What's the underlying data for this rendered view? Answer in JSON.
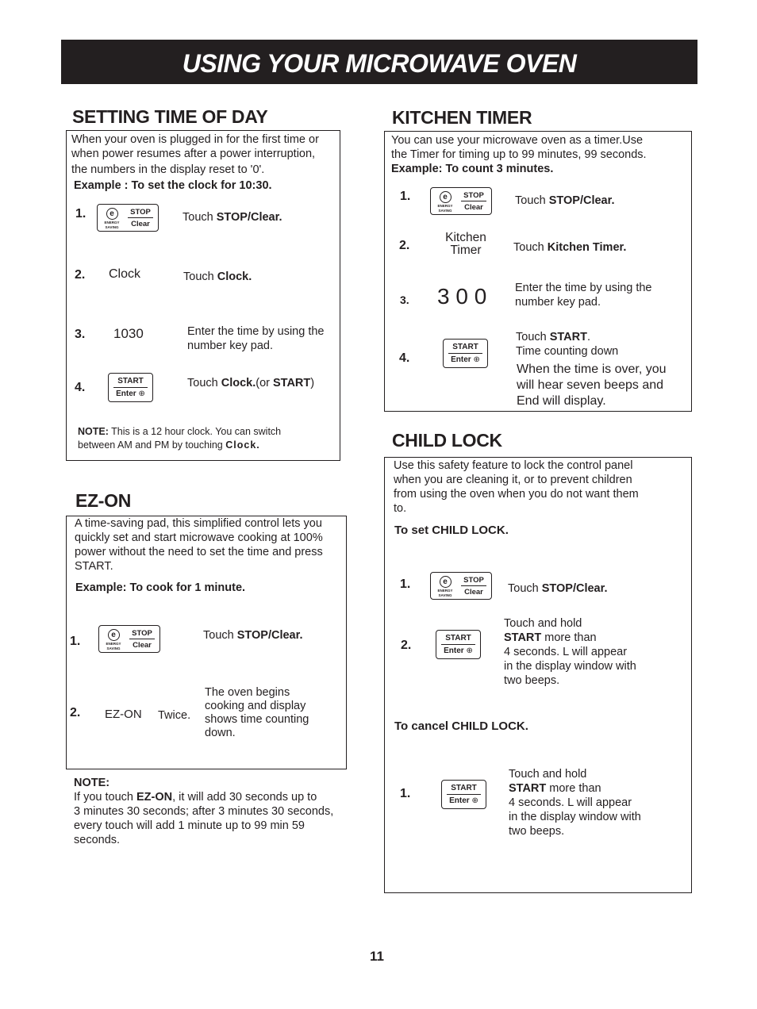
{
  "header": {
    "title": "USING YOUR MICROWAVE OVEN",
    "banner_color": "#231f20"
  },
  "keys": {
    "stop_clear": {
      "eco_glyph": "e",
      "eco_label_1": "ENERGY",
      "eco_label_2": "SAVING",
      "top": "STOP",
      "bottom": "Clear"
    },
    "start_enter": {
      "top": "START",
      "bottom": "Enter",
      "lock_glyph": "⊕"
    }
  },
  "setting_time": {
    "title": "SETTING TIME OF DAY",
    "intro_1": "When your oven is plugged in for the first time or",
    "intro_2": "when power resumes after a power interruption,",
    "intro_3": "the numbers in the display reset to '0'.",
    "example": "Example : To set the clock for 10:30.",
    "steps": [
      {
        "num": "1.",
        "pad": "STOP/Clear",
        "text_pre": "Touch ",
        "text_bold": "STOP/Clear."
      },
      {
        "num": "2.",
        "pad": "Clock",
        "text_pre": "Touch ",
        "text_bold": "Clock."
      },
      {
        "num": "3.",
        "pad": "1030",
        "text_1": "Enter the time by using the",
        "text_2": "number key pad."
      },
      {
        "num": "4.",
        "pad": "START/Enter",
        "text_pre": "Touch ",
        "text_bold": "Clock.",
        "text_mid": "(or ",
        "text_bold2": "START",
        "text_post": ")"
      }
    ],
    "note_label": "NOTE:",
    "note_1": " This is a 12 hour clock. You can switch",
    "note_2": "between AM and PM by touching ",
    "note_bold": "Clock."
  },
  "ez_on": {
    "title": "EZ-ON",
    "intro_1": "A time-saving pad, this simplified control lets you",
    "intro_2": "quickly set and start microwave cooking at 100%",
    "intro_3": "power without the need to set the time and press",
    "intro_4": "START.",
    "example": "Example: To cook for 1 minute.",
    "steps": [
      {
        "num": "1.",
        "pad": "STOP/Clear",
        "text_pre": "Touch ",
        "text_bold": "STOP/Clear."
      },
      {
        "num": "2.",
        "pad": "EZ-ON",
        "extra": "Twice.",
        "text_1": "The oven begins",
        "text_2": "cooking and display",
        "text_3": "shows time counting",
        "text_4": "down."
      }
    ],
    "note_label": "NOTE:",
    "note_1_pre": "If you touch ",
    "note_1_bold": "EZ-ON",
    "note_1_post": ", it will add 30 seconds up to",
    "note_2": "3 minutes 30 seconds; after 3 minutes 30 seconds,",
    "note_3": "every touch will add 1 minute up to 99 min 59",
    "note_4": "seconds."
  },
  "kitchen_timer": {
    "title": "KITCHEN TIMER",
    "intro_1": "You can use your microwave oven as a timer.Use",
    "intro_2": "the Timer for timing up to 99 minutes, 99 seconds.",
    "example": "Example: To count 3 minutes.",
    "steps": [
      {
        "num": "1.",
        "pad": "STOP/Clear",
        "text_pre": "Touch ",
        "text_bold": "STOP/Clear."
      },
      {
        "num": "2.",
        "pad_1": "Kitchen",
        "pad_2": "Timer",
        "text_pre": "Touch ",
        "text_bold": "Kitchen Timer."
      },
      {
        "num": "3.",
        "pad": "3 0 0",
        "text_1": "Enter the time by using the",
        "text_2": "number key pad."
      },
      {
        "num": "4.",
        "pad": "START/Enter",
        "text_pre": "Touch ",
        "text_bold": "START",
        "text_post": ".",
        "text_2": "Time counting down",
        "text_3": "When the time is over, you",
        "text_4": "will hear seven beeps and",
        "text_5": "End will display."
      }
    ]
  },
  "child_lock": {
    "title": "CHILD LOCK",
    "intro_1": "Use this safety feature to lock the control panel",
    "intro_2": "when you are cleaning it, or to prevent children",
    "intro_3": "from using the oven when you do not want them",
    "intro_4": "to.",
    "set_heading": "To set CHILD LOCK.",
    "set_steps": [
      {
        "num": "1.",
        "pad": "STOP/Clear",
        "text_pre": "Touch ",
        "text_bold": "STOP/Clear."
      },
      {
        "num": "2.",
        "pad": "START/Enter",
        "text_1": "Touch and hold",
        "text_bold": "START",
        "text_2_post": " more than",
        "text_3": "4 seconds. L will appear",
        "text_4": "in the display window with",
        "text_5": "two beeps."
      }
    ],
    "cancel_heading": "To cancel CHILD LOCK.",
    "cancel_steps": [
      {
        "num": "1.",
        "pad": "START/Enter",
        "text_1": "Touch and hold",
        "text_bold": "START",
        "text_2_post": " more than",
        "text_3": "4 seconds. L will appear",
        "text_4": "in the display window with",
        "text_5": "two beeps."
      }
    ]
  },
  "page_number": "11"
}
